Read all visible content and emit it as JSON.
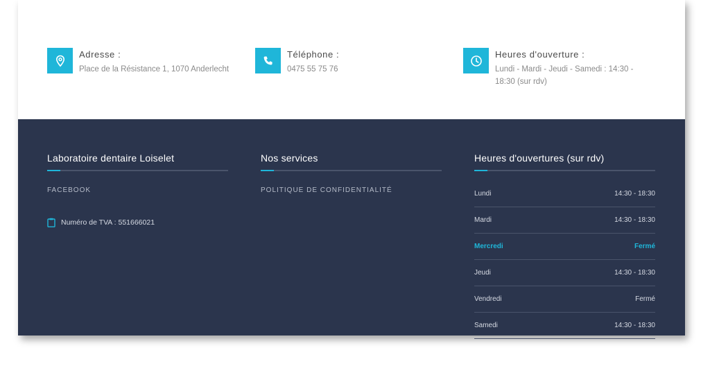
{
  "contact": {
    "address": {
      "title": "Adresse :",
      "value": "Place de la Résistance 1, 1070 Anderlecht",
      "icon": "map-pin-icon"
    },
    "phone": {
      "title": "Téléphone :",
      "value": "0475 55 75 76",
      "icon": "phone-icon"
    },
    "hours": {
      "title": "Heures d'ouverture :",
      "value": "Lundi - Mardi - Jeudi - Samedi : 14:30 - 18:30 (sur rdv)",
      "icon": "clock-icon"
    }
  },
  "footer": {
    "about": {
      "title": "Laboratoire dentaire Loiselet",
      "facebook_label": "FACEBOOK",
      "tva_label": "Numéro de TVA : 551666021"
    },
    "services": {
      "title": "Nos services",
      "privacy_label": "POLITIQUE DE CONFIDENTIALITÉ"
    },
    "opening": {
      "title": "Heures d'ouvertures (sur rdv)",
      "rows": [
        {
          "day": "Lundi",
          "hours": "14:30 - 18:30",
          "today": false
        },
        {
          "day": "Mardi",
          "hours": "14:30 - 18:30",
          "today": false
        },
        {
          "day": "Mercredi",
          "hours": "Fermé",
          "today": true
        },
        {
          "day": "Jeudi",
          "hours": "14:30 - 18:30",
          "today": false
        },
        {
          "day": "Vendredi",
          "hours": "Fermé",
          "today": false
        },
        {
          "day": "Samedi",
          "hours": "14:30 - 18:30",
          "today": false
        }
      ]
    }
  },
  "colors": {
    "accent": "#1fb6d9",
    "footer_bg": "#2b354d",
    "divider": "#4a546b"
  }
}
